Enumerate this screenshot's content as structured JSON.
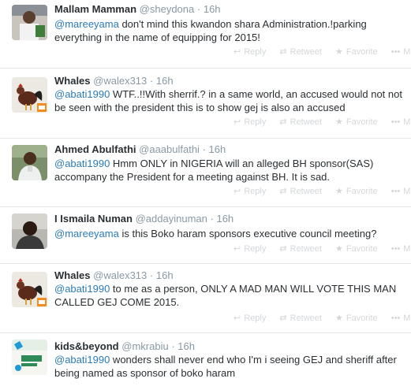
{
  "actions": {
    "reply": "Reply",
    "retweet": "Retweet",
    "favorite": "Favorite",
    "more": "M",
    "reply_icon": "reply-icon",
    "retweet_icon": "retweet-icon",
    "favorite_icon": "star-icon",
    "more_icon": "more-icon"
  },
  "tweets": [
    {
      "fullname": "Mallam Mamman",
      "screenname": "@sheydona",
      "dot": "·",
      "time": "16h",
      "mention": "@mareeyama",
      "line1": " don't mind this kwandon shara Administration.!parking",
      "line2": "everything in the name of equipping for 2015!"
    },
    {
      "fullname": "Whales",
      "screenname": "@walex313",
      "dot": "·",
      "time": "16h",
      "mention": "@abati1990",
      "line1": " WTF..!!With sherrif.? in a same world, an accused would not not",
      "line2": "be seen with the president this is to show gej is also an accused"
    },
    {
      "fullname": "Ahmed Abulfathi",
      "screenname": "@aaabulfathi",
      "dot": "·",
      "time": "16h",
      "mention": "@abati1990",
      "line1": " Hmm ONLY in NIGERIA will an alleged BH sponsor(SAS)",
      "line2": "accompany the President for a meeting against BH. It is sad."
    },
    {
      "fullname": "I Ismaila Numan",
      "screenname": "@addayinuman",
      "dot": "·",
      "time": "16h",
      "mention": "@mareeyama",
      "line1": " is this Boko haram sponsors executive council meeting?",
      "line2": ""
    },
    {
      "fullname": "Whales",
      "screenname": "@walex313",
      "dot": "·",
      "time": "16h",
      "mention": "@abati1990",
      "line1": " to me as a person, ONLY A MAD MAN WILL VOTE THIS MAN",
      "line2": "CALLED GEJ COME 2015."
    },
    {
      "fullname": "kids&beyond",
      "screenname": "@mkrabiu",
      "dot": "·",
      "time": "16h",
      "mention": "@abati1990",
      "line1": " wonders shall never end who I'm i seeing GEJ and sheriff after",
      "line2": "being named as sponsor of boko haram"
    }
  ]
}
